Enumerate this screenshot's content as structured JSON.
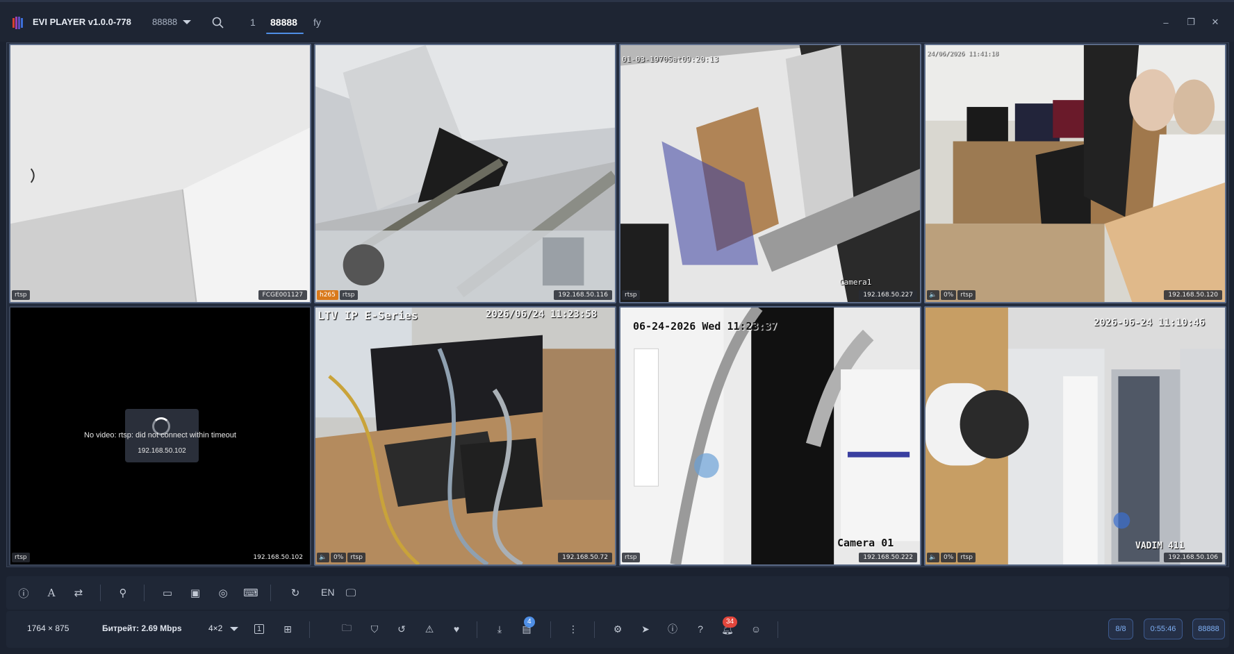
{
  "app": {
    "title": "EVI PLAYER v1.0.0-778",
    "workspace": "88888"
  },
  "tabs": [
    {
      "label": "1"
    },
    {
      "label": "88888"
    },
    {
      "label": "fy"
    }
  ],
  "window_controls": {
    "minimize": "–",
    "restore": "❐",
    "close": "✕"
  },
  "cells": [
    {
      "ip": "FCGE001127",
      "badges": [
        "rtsp"
      ],
      "osd": []
    },
    {
      "ip": "192.168.50.116",
      "badges": [
        "h265",
        "rtsp"
      ],
      "osd": []
    },
    {
      "ip": "192.168.50.227",
      "badges": [
        "rtsp"
      ],
      "osd": [
        "01-03-1970Sat09:20:13",
        "Camera1"
      ]
    },
    {
      "ip": "192.168.50.120",
      "badges": [
        "🔈",
        "0%",
        "rtsp"
      ],
      "osd": [
        "24/06/2026 11:41:18"
      ]
    },
    {
      "ip": "192.168.50.102",
      "badges": [
        "rtsp"
      ],
      "osd": [],
      "no_video_message": "No video: rtsp: did not connect within timeout",
      "no_video_ip": "192.168.50.102"
    },
    {
      "ip": "192.168.50.72",
      "badges": [
        "🔈",
        "0%",
        "rtsp"
      ],
      "osd": [
        "LTV IP E-Series",
        "2026/06/24 11:23:58"
      ]
    },
    {
      "ip": "192.168.50.222",
      "badges": [
        "rtsp"
      ],
      "osd": [
        "06-24-2026 Wed 11:23:37",
        "Camera 01"
      ]
    },
    {
      "ip": "192.168.50.106",
      "badges": [
        "🔈",
        "0%",
        "rtsp"
      ],
      "osd": [
        "2026-06-24 11:10:46",
        "VADIM 411"
      ]
    }
  ],
  "toolbar": {
    "language": "EN"
  },
  "status": {
    "resolution": "1764 × 875",
    "bitrate": "Битрейт: 2.69 Mbps",
    "layout": "4×2",
    "layout_single": "1",
    "downloads_count": "4",
    "notifications_count": "34",
    "cameras": "8/8",
    "uptime": "0:55:46",
    "workspace": "88888"
  },
  "colors": {
    "accent": "#4f8fe6",
    "notification": "#e2463c",
    "h265": "#d9791b"
  }
}
